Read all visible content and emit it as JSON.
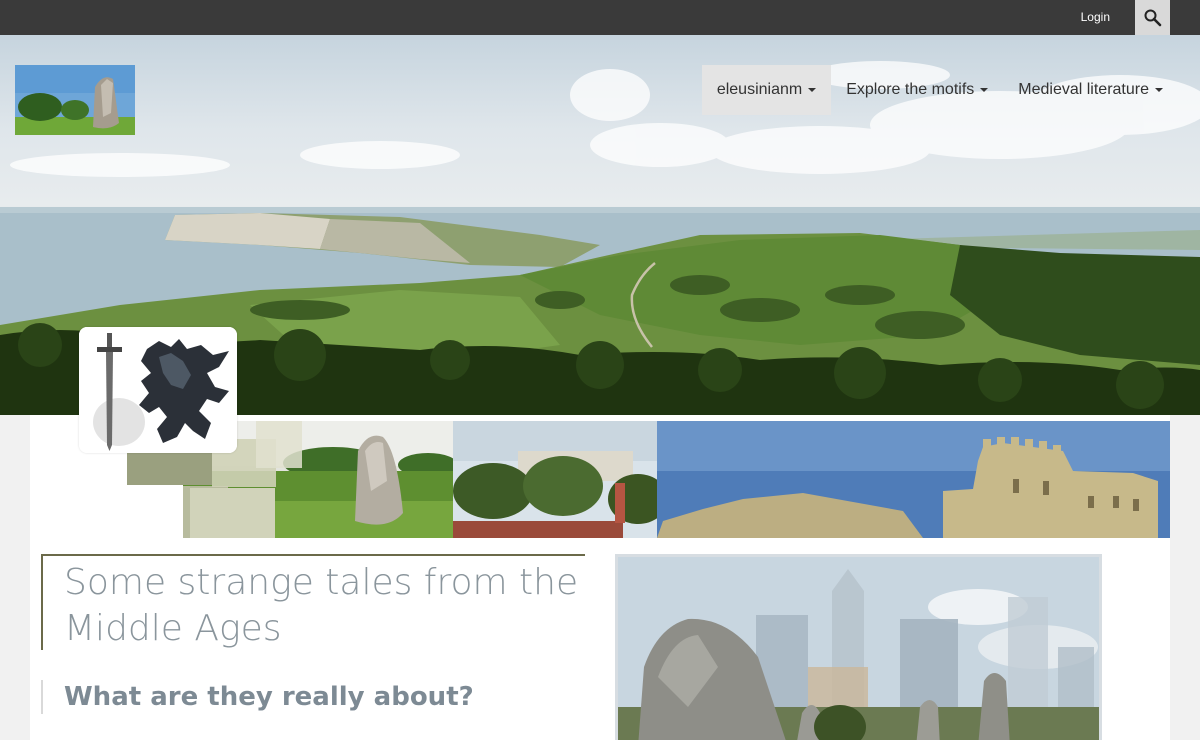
{
  "topbar": {
    "login_label": "Login"
  },
  "nav": {
    "items": [
      {
        "label": "eleusinianm"
      },
      {
        "label": "Explore the motifs"
      },
      {
        "label": "Medieval literature"
      }
    ]
  },
  "content": {
    "title": "Some strange tales from the Middle Ages",
    "subtitle": "What are they really about?"
  },
  "colors": {
    "topbar": "#3a3a3a",
    "title_text": "#8a959c",
    "subtitle_text": "#7d8a94",
    "title_rule": "#6b6a4a"
  }
}
